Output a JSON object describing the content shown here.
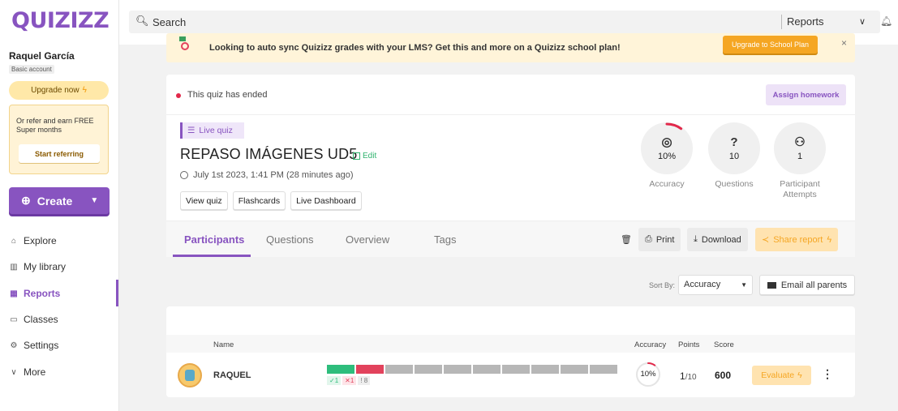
{
  "brand": {
    "logo": "QUIZIZZ"
  },
  "sidebar": {
    "user_name": "Raquel García",
    "account_type": "Basic account",
    "upgrade_label": "Upgrade now",
    "refer_text": "Or refer and earn FREE Super months",
    "refer_button": "Start referring",
    "create_label": "Create",
    "items": [
      {
        "label": "Explore",
        "icon": "explore-icon"
      },
      {
        "label": "My library",
        "icon": "library-icon"
      },
      {
        "label": "Reports",
        "icon": "reports-icon",
        "active": true
      },
      {
        "label": "Classes",
        "icon": "classes-icon"
      },
      {
        "label": "Settings",
        "icon": "settings-icon"
      },
      {
        "label": "More",
        "icon": "chevron-down-icon"
      }
    ]
  },
  "search": {
    "placeholder": "Search",
    "scope": "Reports"
  },
  "banner": {
    "text": "Looking to auto sync Quizizz grades with your LMS? Get this and more on a Quizizz school plan!",
    "button": "Upgrade to School Plan",
    "close": "×"
  },
  "quiz": {
    "status": "This quiz has ended",
    "assign_button": "Assign homework",
    "type_badge": "Live quiz",
    "title": "REPASO IMÁGENES UD5",
    "edit_label": "Edit",
    "date": "July 1st 2023, 1:41 PM (28 minutes ago)",
    "actions": [
      "View quiz",
      "Flashcards",
      "Live Dashboard"
    ],
    "stats": [
      {
        "value": "10%",
        "label": "Accuracy",
        "glyph": "◎",
        "fraction": 0.1
      },
      {
        "value": "10",
        "label": "Questions",
        "glyph": "?"
      },
      {
        "value": "1",
        "label": "Participant Attempts",
        "glyph": "⚇"
      }
    ]
  },
  "tabs": [
    "Participants",
    "Questions",
    "Overview",
    "Tags"
  ],
  "toolbar": {
    "delete": "🗑",
    "print": "Print",
    "download": "Download",
    "share": "Share report"
  },
  "sort": {
    "label": "Sort By:",
    "value": "Accuracy",
    "email": "Email all parents"
  },
  "table": {
    "headers": {
      "name": "Name",
      "accuracy": "Accuracy",
      "points": "Points",
      "score": "Score"
    },
    "rows": [
      {
        "name": "RAQUEL",
        "correct": "✓1",
        "incorrect": "✕1",
        "skipped": "! 8",
        "accuracy": "10%",
        "accuracy_fraction": 0.1,
        "points": "1",
        "points_total": "/10",
        "score": "600",
        "evaluate": "Evaluate",
        "answers": [
          "correct",
          "incorrect",
          "none",
          "none",
          "none",
          "none",
          "none",
          "none",
          "none",
          "none"
        ]
      }
    ]
  },
  "colors": {
    "brand": "#8854c0",
    "correct": "#2ebd7c",
    "incorrect": "#e2425c",
    "accent": "#f5a623"
  }
}
